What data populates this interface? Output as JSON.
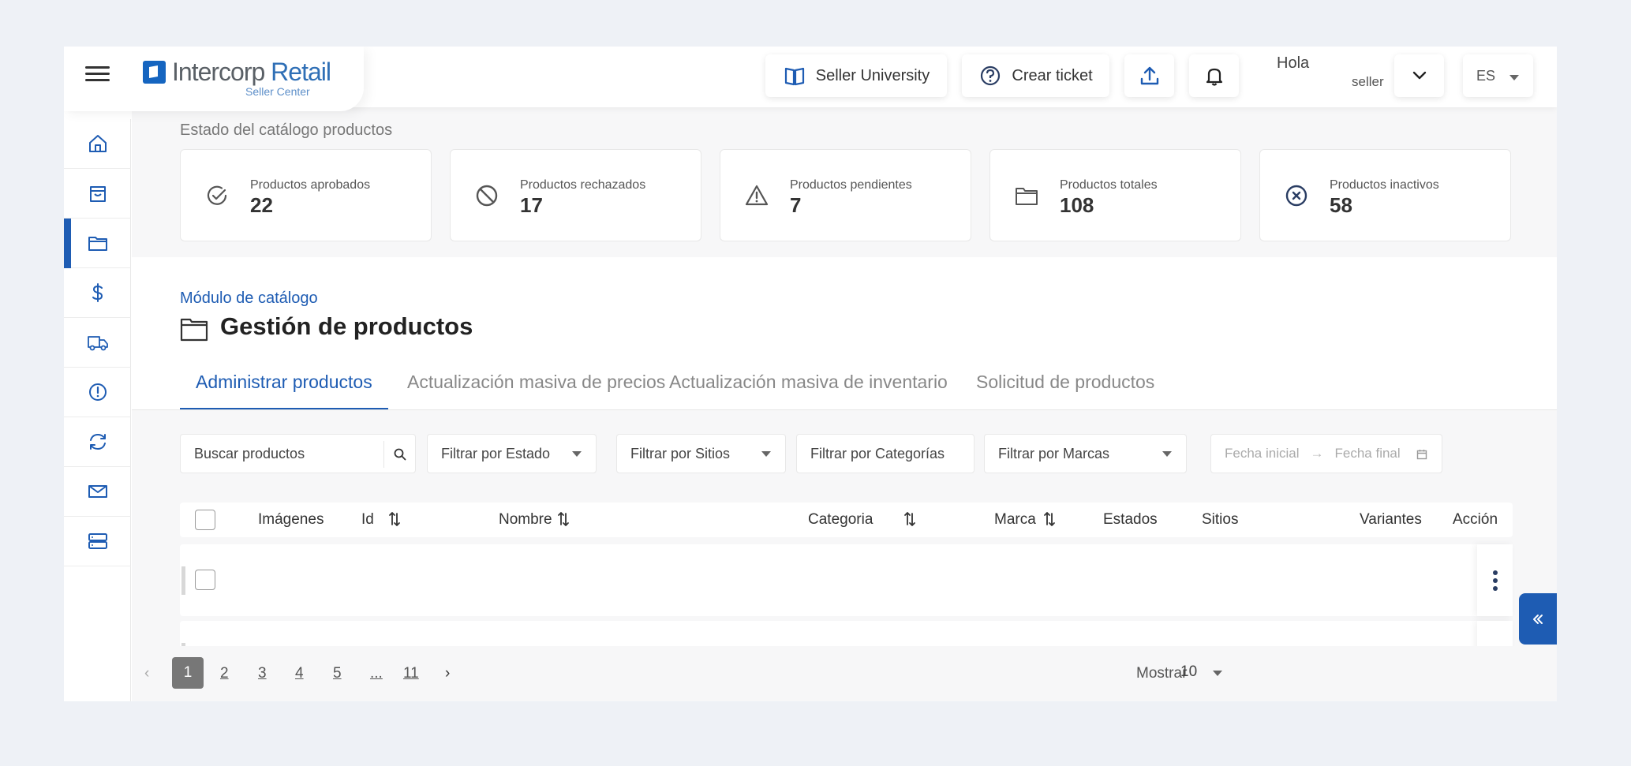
{
  "header": {
    "logo_name_a": "Intercorp",
    "logo_name_b": "Retail",
    "logo_sub": "Seller Center",
    "university_label": "Seller University",
    "ticket_label": "Crear ticket",
    "greeting": "Hola",
    "username": "seller",
    "language": "ES"
  },
  "sidebar": {
    "items": [
      {
        "name": "home-icon"
      },
      {
        "name": "shopping-bag-icon"
      },
      {
        "name": "folder-icon",
        "active": true
      },
      {
        "name": "dollar-icon"
      },
      {
        "name": "truck-icon"
      },
      {
        "name": "alert-icon"
      },
      {
        "name": "refresh-icon"
      },
      {
        "name": "mail-icon"
      },
      {
        "name": "server-icon"
      }
    ]
  },
  "stats": {
    "title": "Estado del catálogo productos",
    "cards": [
      {
        "label": "Productos aprobados",
        "value": "22",
        "icon": "check-circle-icon"
      },
      {
        "label": "Productos rechazados",
        "value": "17",
        "icon": "ban-icon"
      },
      {
        "label": "Productos pendientes",
        "value": "7",
        "icon": "warning-icon"
      },
      {
        "label": "Productos totales",
        "value": "108",
        "icon": "folder-icon"
      },
      {
        "label": "Productos inactivos",
        "value": "58",
        "icon": "x-circle-icon"
      }
    ]
  },
  "page": {
    "breadcrumb": "Módulo de catálogo",
    "title": "Gestión de productos",
    "tabs": [
      {
        "label": "Administrar productos",
        "active": true
      },
      {
        "label": "Actualización masiva de precios"
      },
      {
        "label": "Actualización masiva de inventario"
      },
      {
        "label": "Solicitud de productos"
      }
    ]
  },
  "filters": {
    "search_placeholder": "Buscar productos",
    "estado": "Filtrar por Estado",
    "sitios": "Filtrar por Sitios",
    "categorias": "Filtrar por Categorías",
    "marcas": "Filtrar por Marcas",
    "fecha_inicial": "Fecha inicial",
    "fecha_final": "Fecha final"
  },
  "table": {
    "columns": [
      "Imágenes",
      "Id",
      "Nombre",
      "Categoria",
      "Marca",
      "Estados",
      "Sitios",
      "Variantes",
      "Acción"
    ]
  },
  "pagination": {
    "pages": [
      "1",
      "2",
      "3",
      "4",
      "5",
      "...",
      "11"
    ],
    "current": "1",
    "show_label": "Mostrar",
    "per_page": "10"
  },
  "colors": {
    "accent": "#1e5cb3",
    "background": "#eef1f6"
  }
}
